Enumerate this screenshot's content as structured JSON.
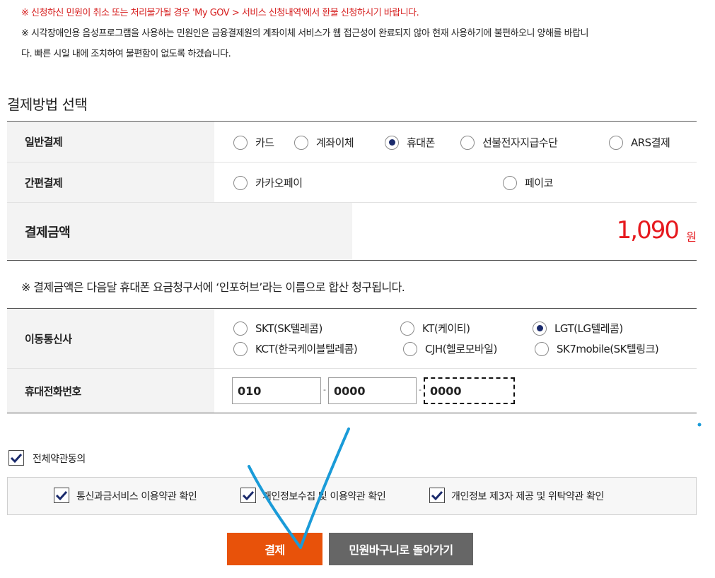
{
  "notices": {
    "refund": "※ 신청하신 민원이 취소 또는 처리불가될 경우 'My GOV > 서비스 신청내역'에서 환불 신청하시기 바랍니다.",
    "accessibility_line1": "※ 시각장애인용 음성프로그램을 사용하는 민원인은 금융결제원의 계좌이체 서비스가 웹 접근성이 완료되지 않아 현재 사용하기에 불편하오니 양해를 바랍니",
    "accessibility_line2": "다. 빠른 시일 내에 조치하여 불편함이 없도록 하겠습니다."
  },
  "section_title": "결제방법 선택",
  "general_payment": {
    "label": "일반결제",
    "options": [
      "카드",
      "계좌이체",
      "휴대폰",
      "선불전자지급수단",
      "ARS결제"
    ],
    "selected": "휴대폰"
  },
  "easy_payment": {
    "label": "간편결제",
    "options": [
      "카카오페이",
      "페이코"
    ]
  },
  "amount": {
    "label": "결제금액",
    "value": "1,090",
    "unit": "원"
  },
  "charge_note": "※ 결제금액은 다음달 휴대폰 요금청구서에 ‘인포허브’라는 이름으로 합산 청구됩니다.",
  "carrier": {
    "label": "이동통신사",
    "options": [
      "SKT(SK텔레콤)",
      "KT(케이티)",
      "LGT(LG텔레콤)",
      "KCT(한국케이블텔레콤)",
      "CJH(헬로모바일)",
      "SK7mobile(SK텔링크)"
    ],
    "selected": "LGT(LG텔레콤)"
  },
  "phone": {
    "label": "휴대전화번호",
    "part1": "010",
    "part2": "0000",
    "part3": "0000",
    "separator": "-"
  },
  "agree_all": {
    "label": "전체약관동의",
    "checked": true
  },
  "terms": [
    {
      "label": "통신과금서비스 이용약관 확인",
      "checked": true
    },
    {
      "label": "개인정보수집 및 이용약관 확인",
      "checked": true
    },
    {
      "label": "개인정보 제3자 제공 및 위탁약관 확인",
      "checked": true
    }
  ],
  "buttons": {
    "pay": "결제",
    "back": "민원바구니로 돌아가기"
  },
  "colors": {
    "notice_red": "#d61f1f",
    "amount_red": "#e6191e",
    "pay_button": "#e8520a",
    "back_button": "#666666",
    "radio_dot": "#1a2a6c",
    "check_mark": "#1a2a6c",
    "annotation_blue": "#1a9bd8"
  }
}
